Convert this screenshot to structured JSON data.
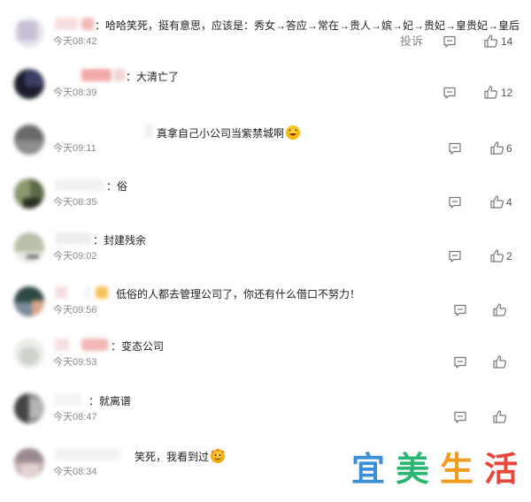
{
  "comments": [
    {
      "text": "：哈哈笑死，挺有意思，应该是：秀女→答应→常在→贵人→嫔→妃→贵妃→皇贵妃→皇后",
      "time": "今天08:42",
      "report": "投诉",
      "likes": "14"
    },
    {
      "text": "：大清亡了",
      "time": "今天08:39",
      "likes": "12"
    },
    {
      "text": "真拿自己小公司当紫禁城啊",
      "time": "今天09:11",
      "likes": "6"
    },
    {
      "text": "：俗",
      "time": "今天08:35",
      "likes": "4"
    },
    {
      "text": "：封建残余",
      "time": "今天09:02",
      "likes": "2"
    },
    {
      "text": "低俗的人都去管理公司了，你还有什么借口不努力！",
      "time": "今天09:56",
      "likes": ""
    },
    {
      "text": "：变态公司",
      "time": "今天09:53",
      "likes": ""
    },
    {
      "text": "：就离谱",
      "time": "今天08:47",
      "likes": ""
    },
    {
      "text": "笑死，我看到过",
      "time": "今天08:34",
      "likes": ""
    }
  ],
  "watermark": {
    "chars": [
      "宜",
      "美",
      "生",
      "活"
    ],
    "colors": [
      "#3a8fd6",
      "#2bb673",
      "#f29b1d",
      "#e8473a"
    ]
  },
  "icons": {
    "reply": "comment-reply-icon",
    "like": "thumb-up-icon",
    "emoji_laugh": "laughing-emoji-icon",
    "emoji_party": "party-emoji-icon"
  }
}
